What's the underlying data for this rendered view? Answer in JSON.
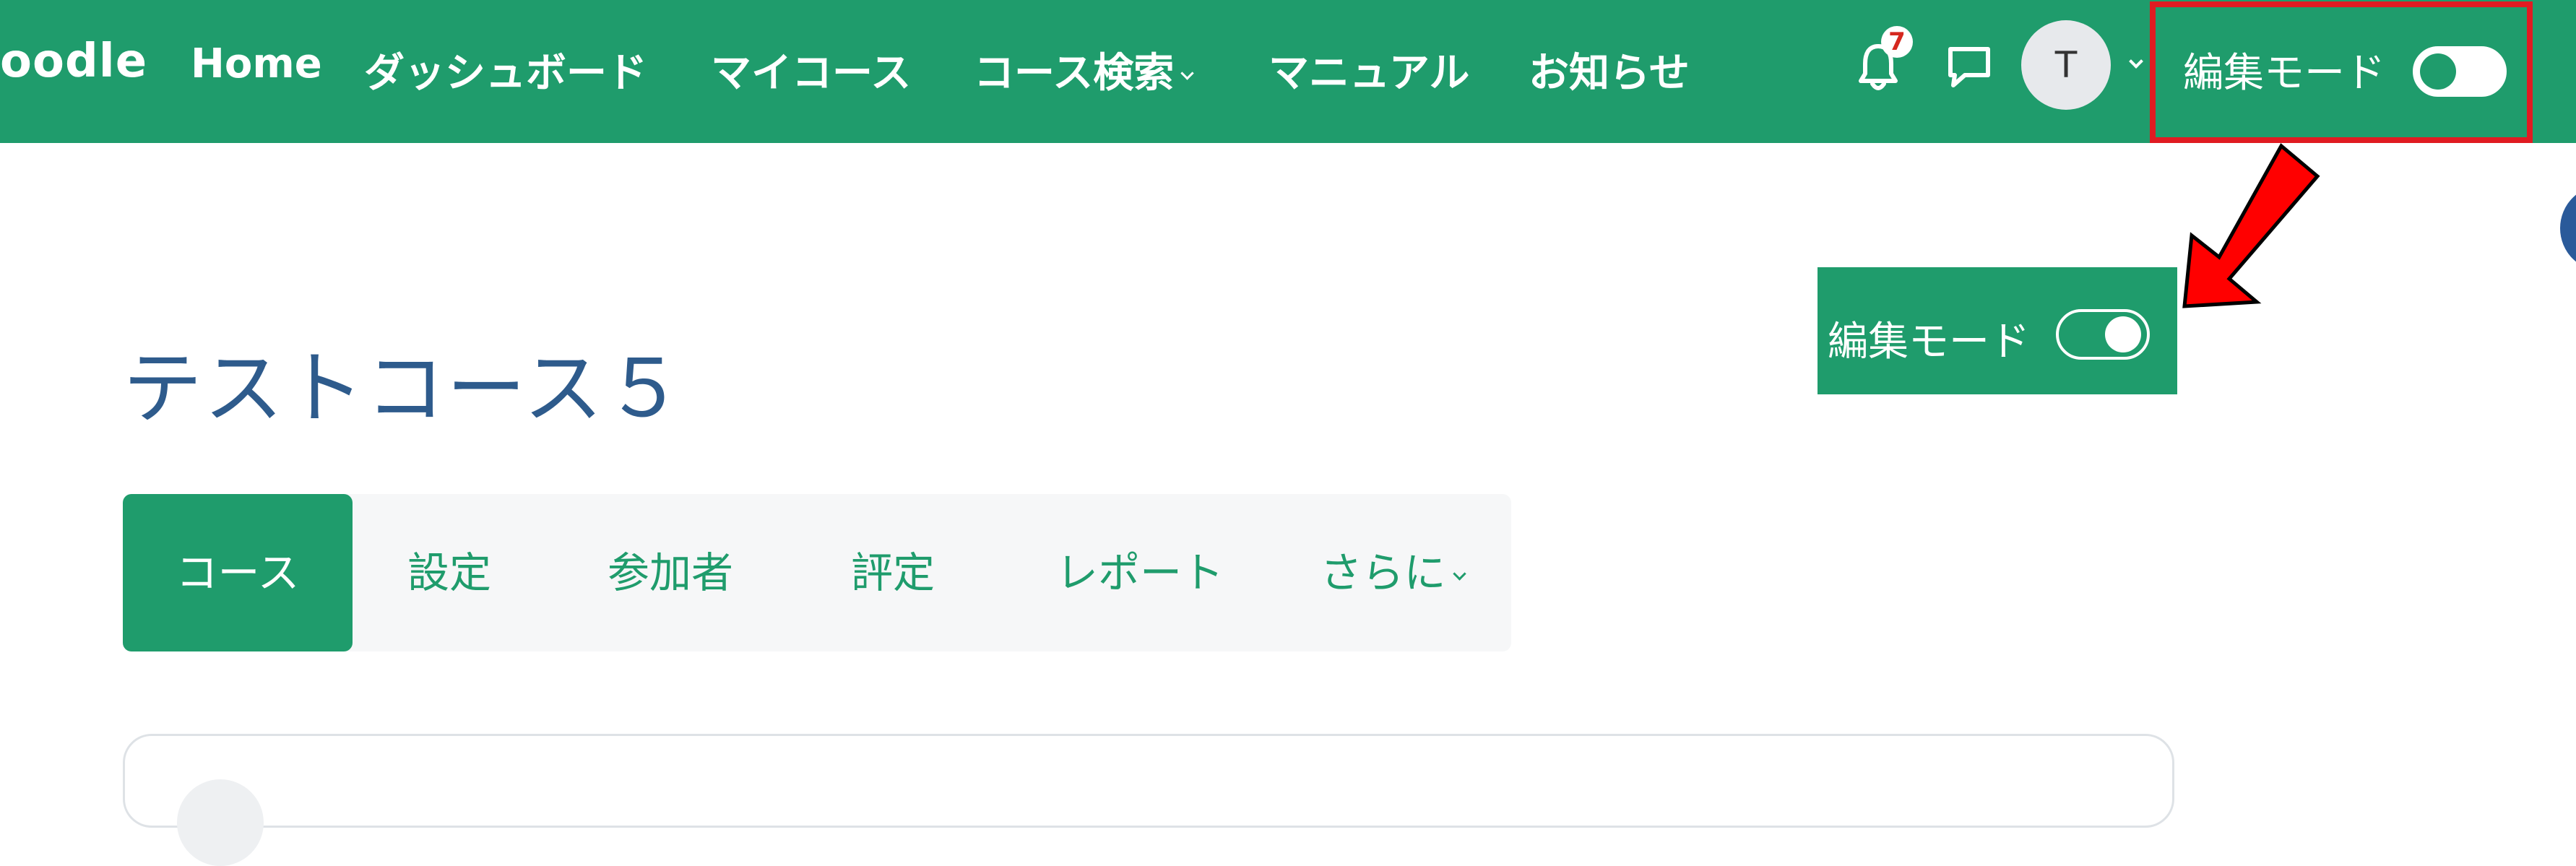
{
  "navbar": {
    "brand": "oodle",
    "items": [
      {
        "label": "Home"
      },
      {
        "label": "ダッシュボード"
      },
      {
        "label": "マイコース"
      },
      {
        "label": "コース検索"
      },
      {
        "label": "マニュアル"
      },
      {
        "label": "お知らせ"
      }
    ],
    "notification_count": "7",
    "avatar_initial": "T",
    "edit_mode_label": "編集モード",
    "edit_mode_on": false
  },
  "callout": {
    "edit_mode_label": "編集モード",
    "edit_mode_on": true
  },
  "page": {
    "title": "テストコース５"
  },
  "tabs": [
    {
      "label": "コース",
      "active": true
    },
    {
      "label": "設定",
      "active": false
    },
    {
      "label": "参加者",
      "active": false
    },
    {
      "label": "評定",
      "active": false
    },
    {
      "label": "レポート",
      "active": false
    },
    {
      "label": "さらに",
      "active": false
    }
  ],
  "colors": {
    "brand_green": "#1f9c6c",
    "title_blue": "#2e5b8c",
    "highlight_red": "#e01b22",
    "badge_red": "#d5281f"
  },
  "icons": [
    "bell-icon",
    "chat-icon",
    "chevron-down-icon",
    "red-arrow-icon"
  ]
}
